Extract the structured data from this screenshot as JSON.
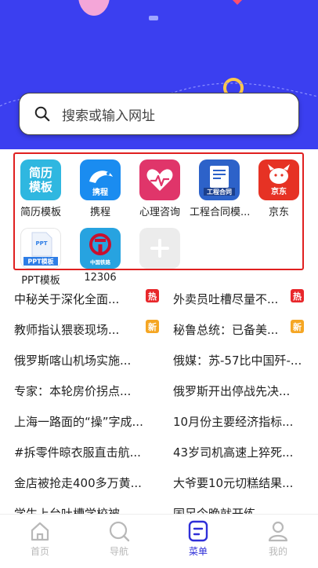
{
  "search": {
    "placeholder": "搜索或输入网址"
  },
  "apps": [
    {
      "label": "简历模板",
      "tile_text": "简历\n模板",
      "color": "#2fb7e0"
    },
    {
      "label": "携程",
      "tile_text": "携程",
      "color": "#1a8cf0"
    },
    {
      "label": "心理咨询",
      "tile_text": "",
      "color": "#e0356a"
    },
    {
      "label": "工程合同模...",
      "tile_text": "工程合同",
      "color": "#2d62c9"
    },
    {
      "label": "京东",
      "tile_text": "京东",
      "color": "#e63224"
    },
    {
      "label": "PPT模板",
      "tile_text": "PPT模板",
      "color": "#2f7ee6"
    },
    {
      "label": "12306",
      "tile_text": "中国铁路",
      "color": "#27a3e0"
    }
  ],
  "add_app": {
    "label": ""
  },
  "news": [
    {
      "left": {
        "title": "中秘关于深化全面...",
        "badge": "热",
        "badge_color": "#e8272b"
      },
      "right": {
        "title": "外卖员吐槽尽量不...",
        "badge": "热",
        "badge_color": "#e8272b"
      }
    },
    {
      "left": {
        "title": "教师指认猥亵现场...",
        "badge": "新",
        "badge_color": "#f5a623"
      },
      "right": {
        "title": "秘鲁总统：已备美...",
        "badge": "新",
        "badge_color": "#f5a623"
      }
    },
    {
      "left": {
        "title": "俄罗斯喀山机场实施..."
      },
      "right": {
        "title": "俄媒：苏-57比中国歼-..."
      }
    },
    {
      "left": {
        "title": "专家：本轮房价拐点..."
      },
      "right": {
        "title": "俄罗斯开出停战先决..."
      }
    },
    {
      "left": {
        "title": "上海一路面的“操”字成..."
      },
      "right": {
        "title": "10月份主要经济指标..."
      }
    },
    {
      "left": {
        "title": "#拆零件晾衣服直击航..."
      },
      "right": {
        "title": "43岁司机高速上猝死..."
      }
    },
    {
      "left": {
        "title": "金店被抢走400多万黄..."
      },
      "right": {
        "title": "大爷要10元切糕结果..."
      }
    },
    {
      "left": {
        "title": "学生上台吐槽学校被..."
      },
      "right": {
        "title": "国足今晚就开练..."
      }
    }
  ],
  "tabs": [
    {
      "label": "首页",
      "icon": "home-icon"
    },
    {
      "label": "导航",
      "icon": "compass-icon"
    },
    {
      "label": "菜单",
      "icon": "menu-icon"
    },
    {
      "label": "我的",
      "icon": "user-icon"
    }
  ],
  "colors": {
    "hero_bg": "#3b3ff0",
    "highlight_border": "#e02020",
    "tab_active": "#2f2fd8",
    "tab_inactive": "#b8b8b8"
  }
}
